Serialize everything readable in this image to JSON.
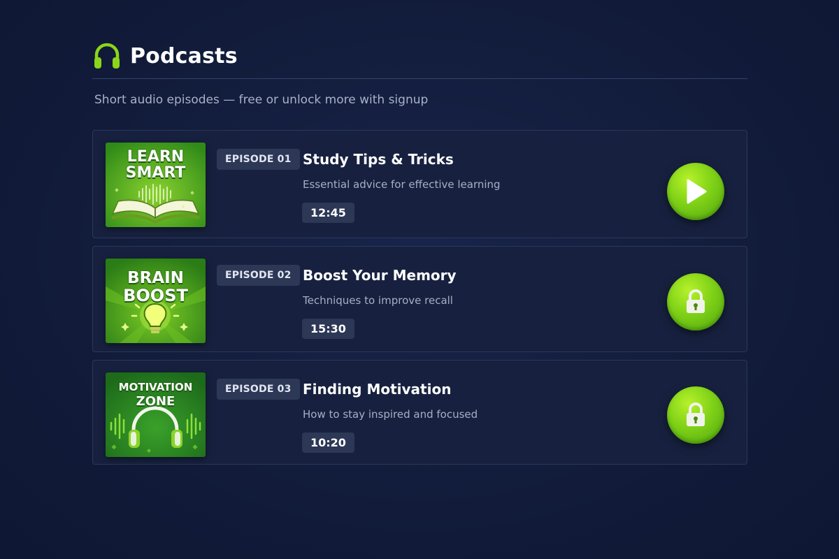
{
  "header": {
    "title": "Podcasts",
    "subtitle": "Short audio episodes — free or unlock more with signup",
    "icon": "headphones-icon"
  },
  "colors": {
    "accent": "#8bd618",
    "background": "#121c3b",
    "card": "#17213f",
    "badge": "#2d3756"
  },
  "episodes": [
    {
      "badge": "EPISODE 01",
      "title": "Study Tips & Tricks",
      "description": "Essential advice for effective learning",
      "duration": "12:45",
      "thumb_line1": "LEARN",
      "thumb_line2": "SMART",
      "action_icon": "play-icon",
      "locked": false
    },
    {
      "badge": "EPISODE 02",
      "title": "Boost Your Memory",
      "description": "Techniques to improve recall",
      "duration": "15:30",
      "thumb_line1": "BRAIN",
      "thumb_line2": "BOOST",
      "action_icon": "lock-icon",
      "locked": true
    },
    {
      "badge": "EPISODE 03",
      "title": "Finding Motivation",
      "description": "How to stay inspired and focused",
      "duration": "10:20",
      "thumb_line1": "MOTIVATION",
      "thumb_line2": "ZONE",
      "action_icon": "lock-icon",
      "locked": true
    }
  ]
}
